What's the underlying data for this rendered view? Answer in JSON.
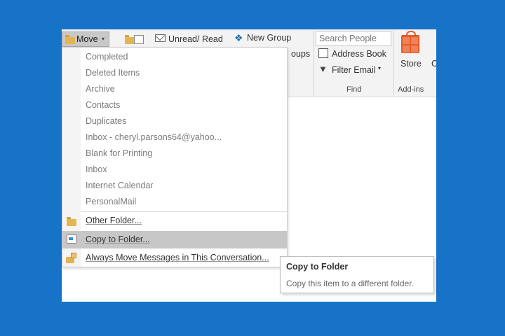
{
  "ribbon": {
    "move_label": "Move",
    "move_arrow": "▾",
    "unread_read_label": "Unread/ Read",
    "new_group_label": "New Group",
    "groups_partial": "oups",
    "search_placeholder": "Search People",
    "address_book_label": "Address Book",
    "filter_email_label": "Filter Email",
    "filter_arrow": "▾",
    "find_group_label": "Find",
    "store_label": "Store",
    "addins_group_label": "Add-ins",
    "clipped_label": "C"
  },
  "move_menu": {
    "folders": [
      {
        "label": "Completed"
      },
      {
        "label": "Deleted Items"
      },
      {
        "label": "Archive"
      },
      {
        "label": "Contacts"
      },
      {
        "label": "Duplicates"
      },
      {
        "label": "Inbox - cheryl.parsons64@yahoo..."
      },
      {
        "label": "Blank for Printing"
      },
      {
        "label": "Inbox"
      },
      {
        "label": "Internet Calendar"
      },
      {
        "label": "PersonalMail"
      }
    ],
    "other_folder": "Other Folder...",
    "copy_to_folder": "Copy to Folder...",
    "always_move": "Always Move Messages in This Conversation..."
  },
  "tooltip": {
    "title": "Copy to Folder",
    "description": "Copy this item to a different folder."
  },
  "icons": {
    "move": "folder-icon",
    "rules": "folder-rules-icon",
    "unread": "envelope-icon",
    "new_group": "people-group-icon",
    "address_book": "address-book-icon",
    "filter": "funnel-icon",
    "store": "store-bag-icon",
    "copy": "copy-folder-icon",
    "always_move": "always-move-icon"
  },
  "colors": {
    "background": "#1673c8",
    "store_orange": "#e85a24",
    "highlight": "#c7c7c7"
  }
}
